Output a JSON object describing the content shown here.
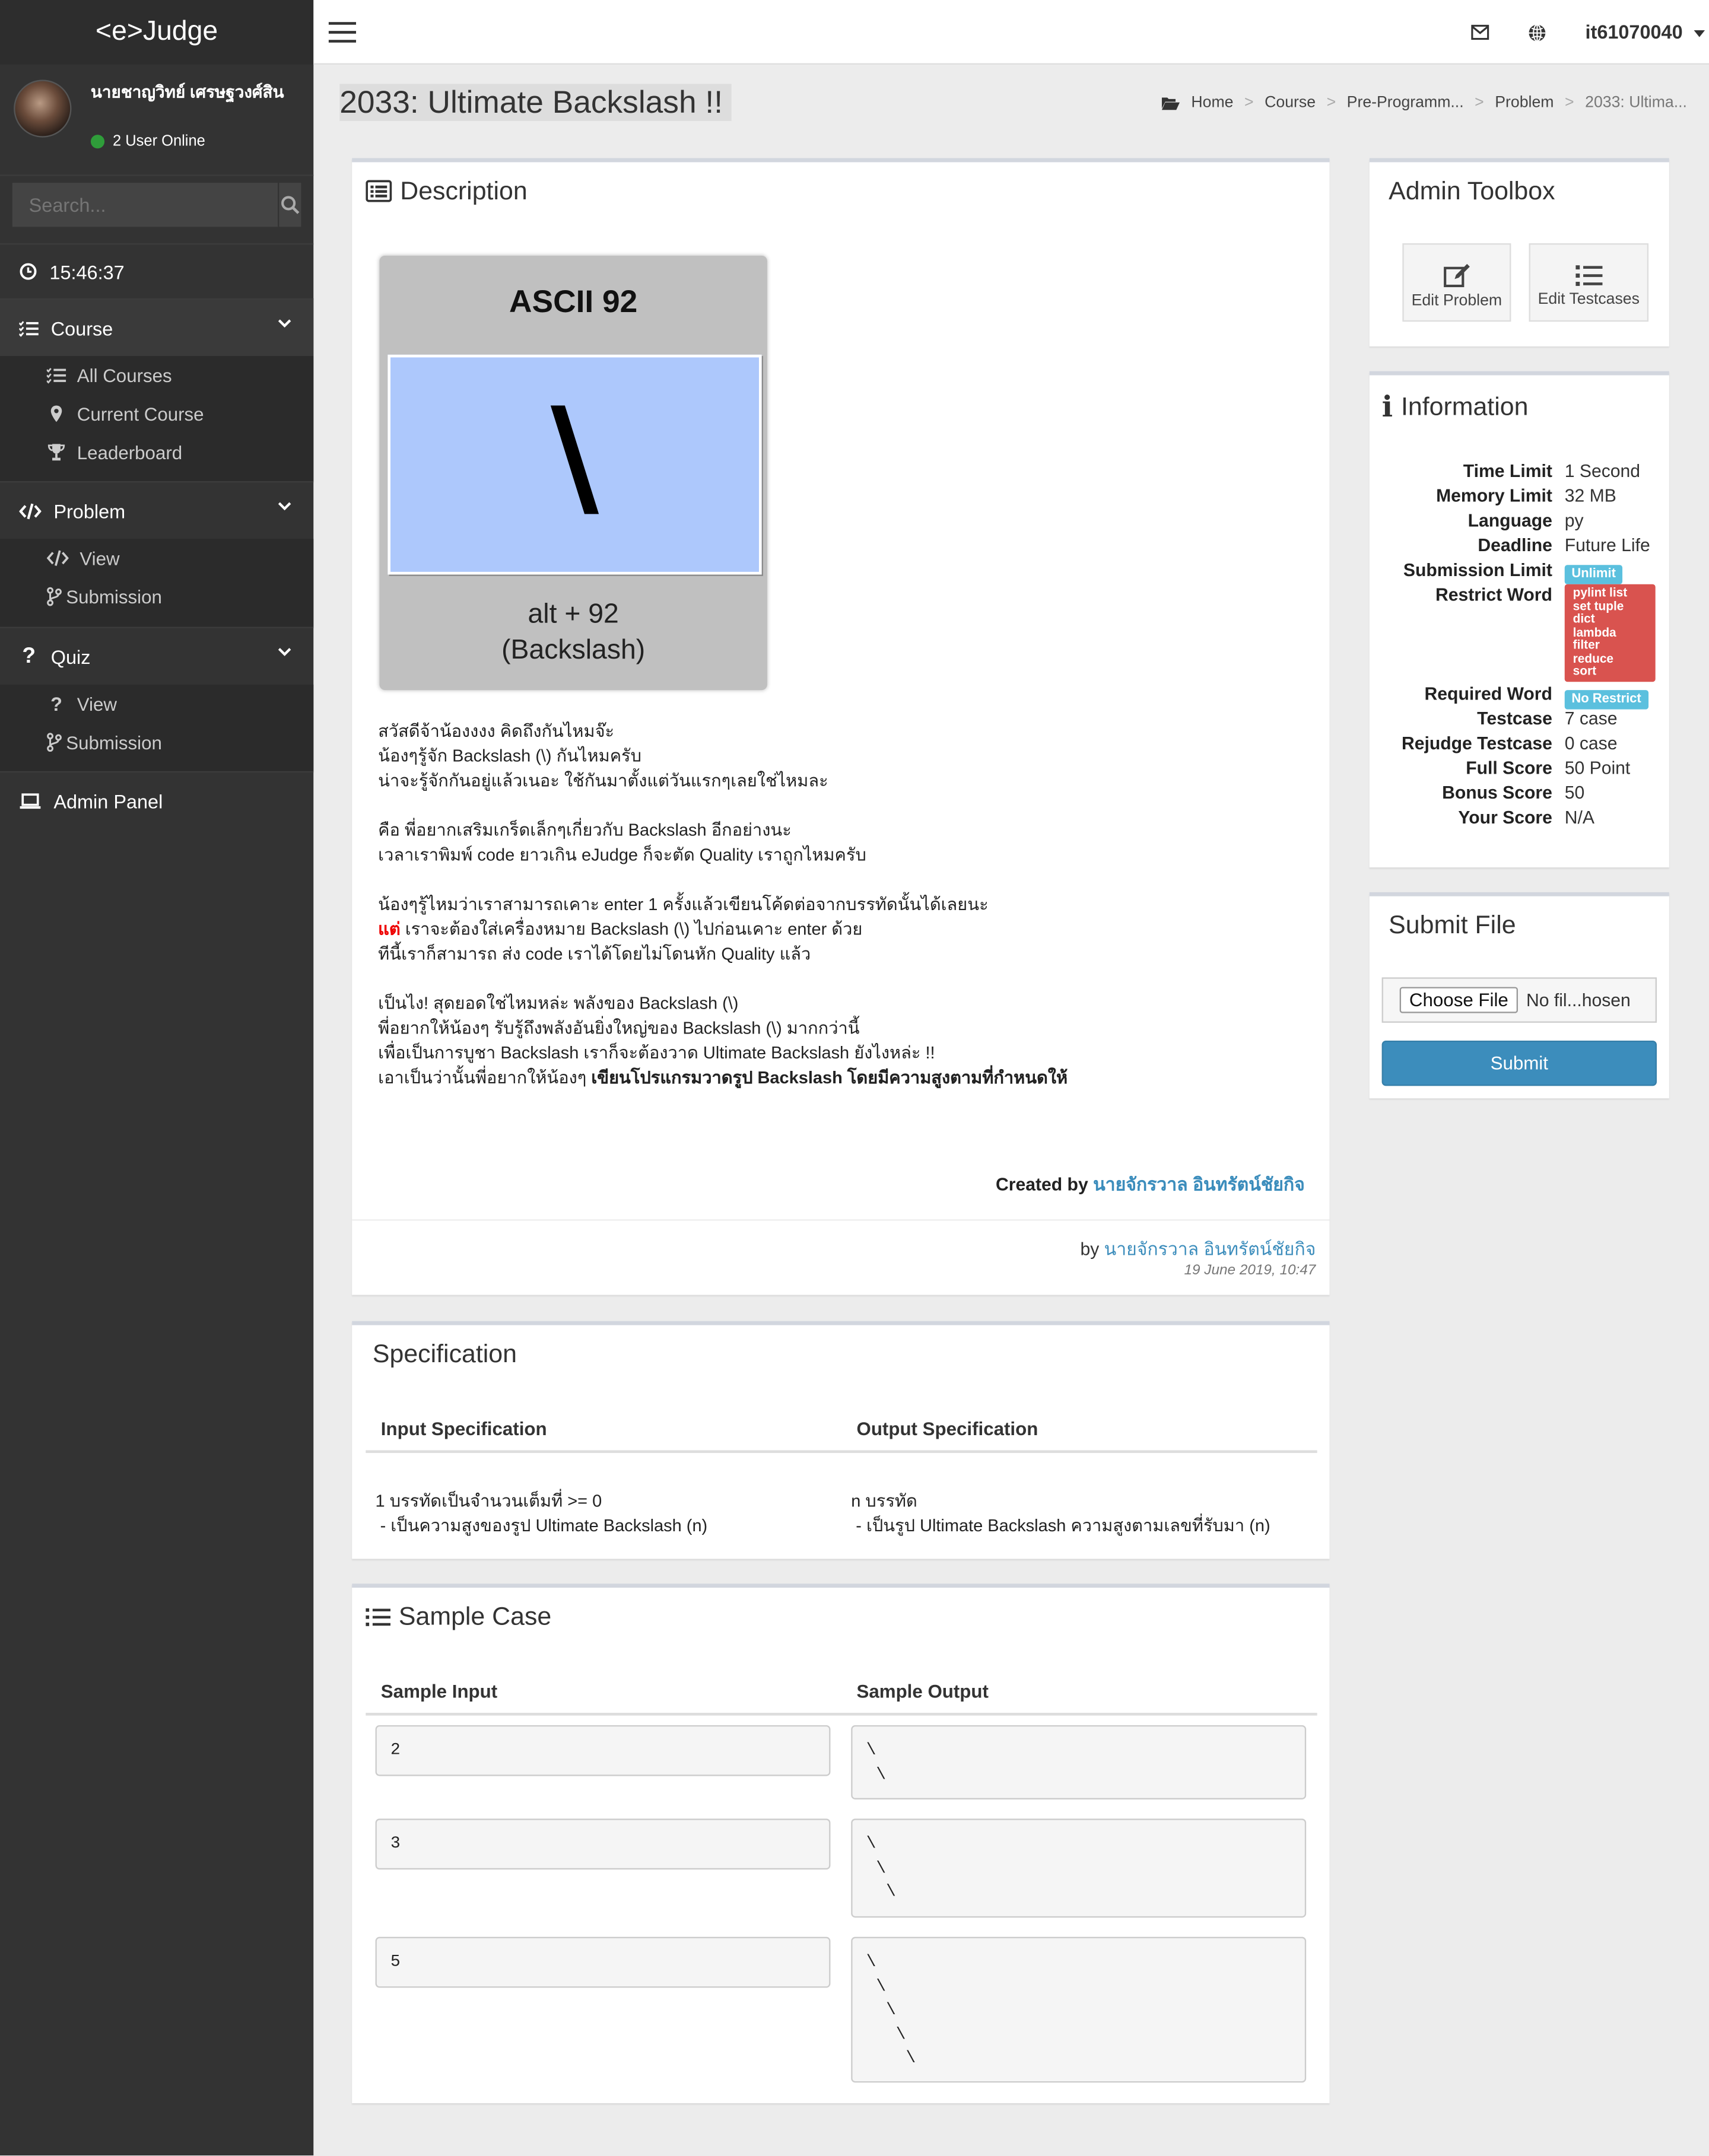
{
  "app": {
    "logo": "<e>Judge"
  },
  "sidebar": {
    "user_name": "นายชาญวิทย์ เศรษฐวงศ์สิน",
    "online": "2 User Online",
    "search_placeholder": "Search...",
    "clock": "15:46:37",
    "course": {
      "label": "Course",
      "items": [
        {
          "label": "All Courses"
        },
        {
          "label": "Current Course"
        },
        {
          "label": "Leaderboard"
        }
      ]
    },
    "problem": {
      "label": "Problem",
      "items": [
        {
          "label": "View"
        },
        {
          "label": "Submission"
        }
      ]
    },
    "quiz": {
      "label": "Quiz",
      "items": [
        {
          "label": "View"
        },
        {
          "label": "Submission"
        }
      ]
    },
    "admin": "Admin Panel"
  },
  "topbar": {
    "username": "it61070040"
  },
  "page": {
    "title": "2033: Ultimate Backslash !!"
  },
  "breadcrumb": [
    "Home",
    "Course",
    "Pre-Programm...",
    "Problem",
    "2033: Ultima..."
  ],
  "description": {
    "heading": "Description",
    "image": {
      "title": "ASCII 92",
      "symbol": "\\",
      "line1": "alt + 92",
      "line2": "(Backslash)"
    },
    "lines": [
      "สวัสดีจ้าน้องงงง คิดถึงกันไหมจ๊ะ",
      "น้องๆรู้จัก Backslash (\\) กันไหมครับ",
      "น่าจะรู้จักกันอยู่แล้วเนอะ ใช้กันมาตั้งแต่วันแรกๆเลยใช่ไหมละ",
      "",
      "คือ พี่อยากเสริมเกร็ดเล็กๆเกี่ยวกับ Backslash อีกอย่างนะ",
      "เวลาเราพิมพ์ code ยาวเกิน eJudge ก็จะตัด Quality เราถูกไหมครับ",
      "",
      "น้องๆรู้ไหมว่าเราสามารถเคาะ enter 1 ครั้งแล้วเขียนโค้ดต่อจากบรรทัดนั้นได้เลยนะ"
    ],
    "but_word": "แต่",
    "but_rest": " เราจะต้องใส่เครื่องหมาย Backslash (\\) ไปก่อนเคาะ enter ด้วย",
    "lines2": [
      "ทีนี้เราก็สามารถ ส่ง code เราได้โดยไม่โดนหัก Quality แล้ว",
      "",
      "เป็นไง! สุดยอดใช่ไหมหล่ะ พลังของ Backslash (\\)",
      "พี่อยากให้น้องๆ รับรู้ถึงพลังอันยิ่งใหญ่ของ Backslash (\\) มากกว่านี้",
      "เพื่อเป็นการบูชา Backslash เราก็จะต้องวาด Ultimate Backslash ยังไงหล่ะ !!"
    ],
    "last_plain": "เอาเป็นว่านั้นพี่อยากให้น้องๆ ",
    "last_bold": "เขียนโปรแกรมวาดรูป Backslash โดยมีความสูงตามที่กำหนดให้",
    "created_label": "Created by ",
    "created_name": "นายจักรวาล อินทรัตน์ชัยกิจ",
    "by_label": "by ",
    "by_name": "นายจักรวาล อินทรัตน์ชัยกิจ",
    "date": "19 June 2019, 10:47"
  },
  "specification": {
    "heading": "Specification",
    "input_header": "Input Specification",
    "output_header": "Output Specification",
    "input_lines": [
      "1 บรรทัดเป็นจำนวนเต็มที่ >= 0",
      " - เป็นความสูงของรูป Ultimate Backslash (n)"
    ],
    "output_lines": [
      "n บรรทัด",
      " - เป็นรูป Ultimate Backslash ความสูงตามเลขที่รับมา (n)"
    ]
  },
  "samples": {
    "heading": "Sample Case",
    "input_header": "Sample Input",
    "output_header": "Sample Output",
    "cases": [
      {
        "input": "2",
        "output": "\\\n \\"
      },
      {
        "input": "3",
        "output": "\\\n \\\n  \\"
      },
      {
        "input": "5",
        "output": "\\\n \\\n  \\\n   \\\n    \\"
      }
    ]
  },
  "toolbox": {
    "heading": "Admin Toolbox",
    "edit_problem": "Edit Problem",
    "edit_testcases": "Edit Testcases"
  },
  "information": {
    "heading": "Information",
    "time_limit_k": "Time Limit",
    "time_limit_v": "1 Second",
    "memory_k": "Memory Limit",
    "memory_v": "32 MB",
    "language_k": "Language",
    "language_v": "py",
    "deadline_k": "Deadline",
    "deadline_v": "Future Life",
    "sublimit_k": "Submission Limit",
    "sublimit_v": "Unlimit",
    "restrict_k": "Restrict Word",
    "restrict_v": [
      "pylint list",
      "set tuple",
      "dict",
      "lambda",
      "filter",
      "reduce",
      "sort"
    ],
    "required_k": "Required Word",
    "required_v": "No Restrict",
    "testcase_k": "Testcase",
    "testcase_v": "7 case",
    "rejudge_k": "Rejudge Testcase",
    "rejudge_v": "0 case",
    "full_k": "Full Score",
    "full_v": "50 Point",
    "bonus_k": "Bonus Score",
    "bonus_v": "50",
    "your_k": "Your Score",
    "your_v": "N/A"
  },
  "submit": {
    "heading": "Submit File",
    "choose": "Choose File",
    "no_file": "No fil...hosen",
    "button": "Submit"
  },
  "colors": {
    "sidebar": "#333333",
    "accent": "#3c8dbc",
    "info_label": "#5bc0de",
    "danger_label": "#d9534f",
    "online": "#2f9d3a"
  }
}
